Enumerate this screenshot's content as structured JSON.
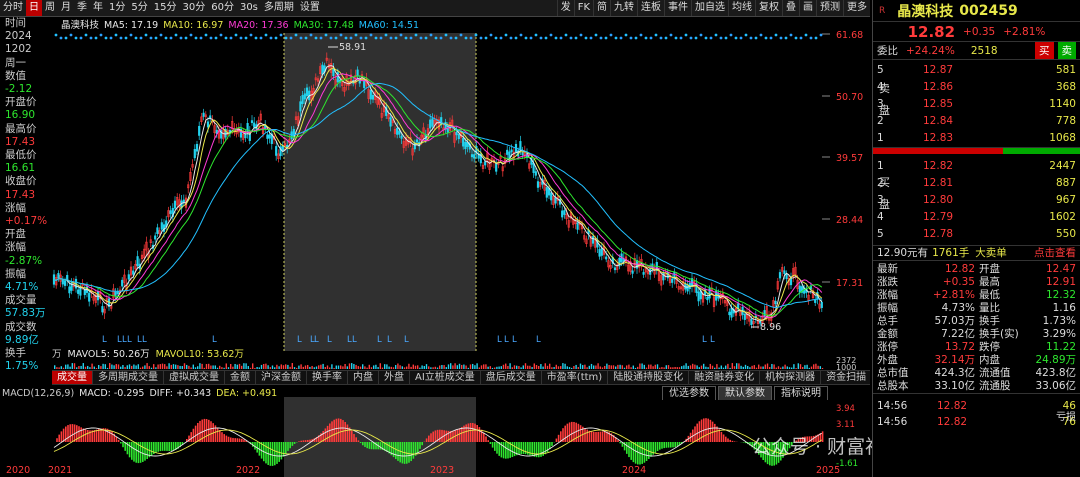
{
  "toolbar": {
    "left": [
      "分时",
      "日",
      "周",
      "月",
      "季",
      "年",
      "1分",
      "5分",
      "15分",
      "30分",
      "60分",
      "30s",
      "多周期",
      "设置"
    ],
    "active": 1,
    "right": [
      "发",
      "FK",
      "简",
      "九转",
      "连板",
      "事件",
      "加自选",
      "均线",
      "复权",
      "叠",
      "画",
      "预测",
      "更多"
    ]
  },
  "ma_legend": {
    "name": "晶澳科技",
    "ma5": "MA5: 17.19",
    "ma10": "MA10: 16.97",
    "ma20": "MA20: 17.36",
    "ma30": "MA30: 17.48",
    "ma60": "MA60: 14.51"
  },
  "left_info": [
    {
      "l": "时间",
      "v": "2024",
      "c": "lbl"
    },
    {
      "l": "",
      "v": "1202",
      "c": "lbl"
    },
    {
      "l": "周一",
      "v": "",
      "c": "lbl"
    },
    {
      "l": "数值",
      "v": "-2.12",
      "c": "vg"
    },
    {
      "l": "开盘价",
      "v": "16.90",
      "c": "vg"
    },
    {
      "l": "最高价",
      "v": "17.43",
      "c": "vr"
    },
    {
      "l": "最低价",
      "v": "16.61",
      "c": "vg"
    },
    {
      "l": "收盘价",
      "v": "17.43",
      "c": "vr"
    },
    {
      "l": "涨幅",
      "v": "+0.17%",
      "c": "vr"
    },
    {
      "l": "开盘",
      "v": "",
      "c": "lbl"
    },
    {
      "l": "涨幅",
      "v": "-2.87%",
      "c": "vg"
    },
    {
      "l": "振幅",
      "v": "4.71%",
      "c": "vc"
    },
    {
      "l": "成交量",
      "v": "57.83万",
      "c": "vc"
    },
    {
      "l": "成交数",
      "v": "9.89亿",
      "c": "vc"
    },
    {
      "l": "换手",
      "v": "1.75%",
      "c": "vc"
    }
  ],
  "price_axis": [
    "61.68",
    "50.70",
    "39.57",
    "28.44",
    "17.31"
  ],
  "peak_label": "58.91",
  "low_label": "8.96",
  "vol_legend": {
    "unit": "万",
    "mavol5": "MAVOL5: 50.26万",
    "mavol10": "MAVOL10: 53.62万"
  },
  "vol_axis": [
    "2372",
    "1000"
  ],
  "ind_tabs": [
    "成交量",
    "多周期成交量",
    "虚拟成交量",
    "金额",
    "沪深金额",
    "换手率",
    "内盘",
    "外盘",
    "AI立桩成交量",
    "盘后成交量",
    "市盈率(ttm)",
    "陆股通持股变化",
    "融资融券变化",
    "机构探测器",
    "资金扫描"
  ],
  "param_tabs": [
    "优选参数",
    "默认参数",
    "指标说明"
  ],
  "macd_legend": {
    "name": "MACD(12,26,9)",
    "macd": "MACD: -0.295",
    "diff": "DIFF: +0.343",
    "dea": "DEA: +0.491"
  },
  "macd_axis": [
    "3.94",
    "3.11",
    "-1.61"
  ],
  "year_labels": [
    "2020",
    "2021",
    "2022",
    "2023",
    "2024",
    "2025"
  ],
  "watermark": "公众号 · 财富福用鸟",
  "rp": {
    "title": "晶澳科技",
    "code": "002459",
    "price": "12.82",
    "chg": "+0.35",
    "pct": "+2.81%",
    "wb_label": "委比",
    "wb": "+24.24%",
    "wb2": "2518",
    "buy": "买",
    "sell": "卖",
    "sell_side": "卖盘",
    "buy_side": "买盘",
    "asks": [
      {
        "n": "5",
        "p": "12.87",
        "v": "581"
      },
      {
        "n": "4",
        "p": "12.86",
        "v": "368"
      },
      {
        "n": "3",
        "p": "12.85",
        "v": "1140"
      },
      {
        "n": "2",
        "p": "12.84",
        "v": "778"
      },
      {
        "n": "1",
        "p": "12.83",
        "v": "1068"
      }
    ],
    "bids": [
      {
        "n": "1",
        "p": "12.82",
        "v": "2447"
      },
      {
        "n": "2",
        "p": "12.81",
        "v": "887"
      },
      {
        "n": "3",
        "p": "12.80",
        "v": "967"
      },
      {
        "n": "4",
        "p": "12.79",
        "v": "1602"
      },
      {
        "n": "5",
        "p": "12.78",
        "v": "550"
      }
    ],
    "bar_a": "12.90元有",
    "bar_b": "1761手",
    "bar_c": "大卖单",
    "bar_d": "点击查看",
    "stats": [
      [
        "最新",
        "12.82",
        "r",
        "开盘",
        "12.47",
        "r"
      ],
      [
        "涨跌",
        "+0.35",
        "r",
        "最高",
        "12.91",
        "r"
      ],
      [
        "涨幅",
        "+2.81%",
        "r",
        "最低",
        "12.32",
        "g"
      ],
      [
        "振幅",
        "4.73%",
        "w",
        "量比",
        "1.16",
        "w"
      ],
      [
        "总手",
        "57.03万",
        "w",
        "换手",
        "1.73%",
        "w"
      ],
      [
        "金额",
        "7.22亿",
        "w",
        "换手(实)",
        "3.29%",
        "w"
      ],
      [
        "涨停",
        "13.72",
        "r",
        "跌停",
        "11.22",
        "g"
      ],
      [
        "外盘",
        "32.14万",
        "r",
        "内盘",
        "24.89万",
        "g"
      ],
      [
        "总市值",
        "424.3亿",
        "w",
        "流通值",
        "423.8亿",
        "w"
      ],
      [
        "总股本",
        "33.10亿",
        "w",
        "流通股",
        "33.06亿",
        "w"
      ]
    ],
    "ticks": [
      {
        "t": "14:56",
        "p": "12.82",
        "v": "46"
      },
      {
        "t": "14:56",
        "p": "12.82",
        "v": "76"
      }
    ],
    "tail": "亏损"
  }
}
